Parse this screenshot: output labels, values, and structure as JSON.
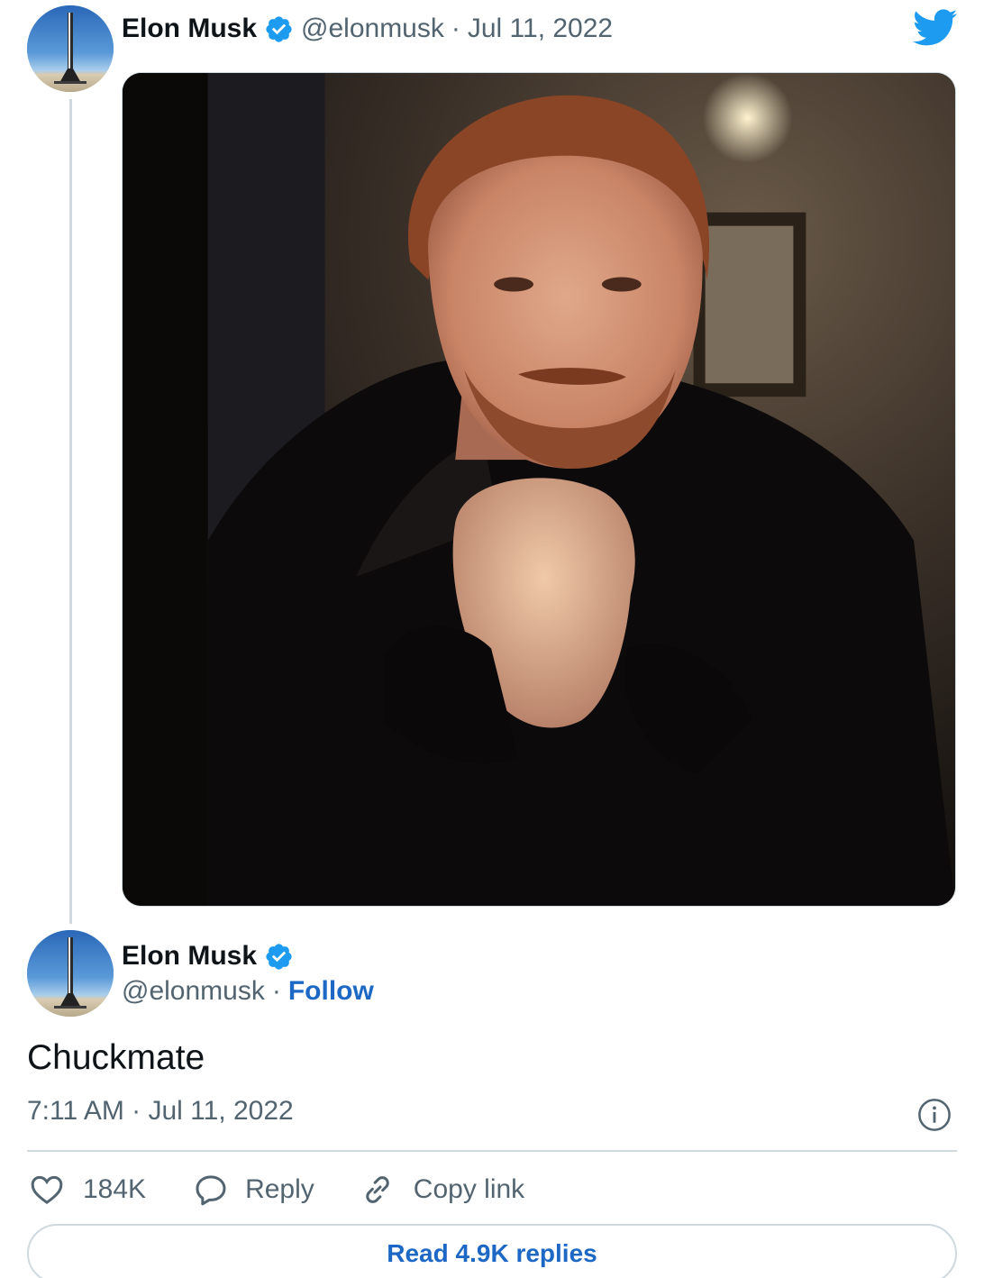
{
  "parent_tweet": {
    "author_name": "Elon Musk",
    "handle": "@elonmusk",
    "separator": "·",
    "date": "Jul 11, 2022"
  },
  "main_tweet": {
    "author_name": "Elon Musk",
    "handle": "@elonmusk",
    "separator": "·",
    "follow_label": "Follow",
    "text": "Chuckmate",
    "timestamp": "7:11 AM · Jul 11, 2022"
  },
  "actions": {
    "like_count": "184K",
    "reply_label": "Reply",
    "copy_link_label": "Copy link"
  },
  "read_replies_label": "Read 4.9K replies",
  "icons": {
    "verified": "verified-badge-icon",
    "brand": "twitter-bird-icon",
    "info": "info-icon",
    "like": "heart-icon",
    "reply": "speech-bubble-icon",
    "copy": "link-icon"
  },
  "colors": {
    "brand_blue": "#1d9bf0",
    "link_blue": "#1d68c4",
    "text_primary": "#0f1419",
    "text_secondary": "#536471",
    "border": "#cfd9de"
  }
}
